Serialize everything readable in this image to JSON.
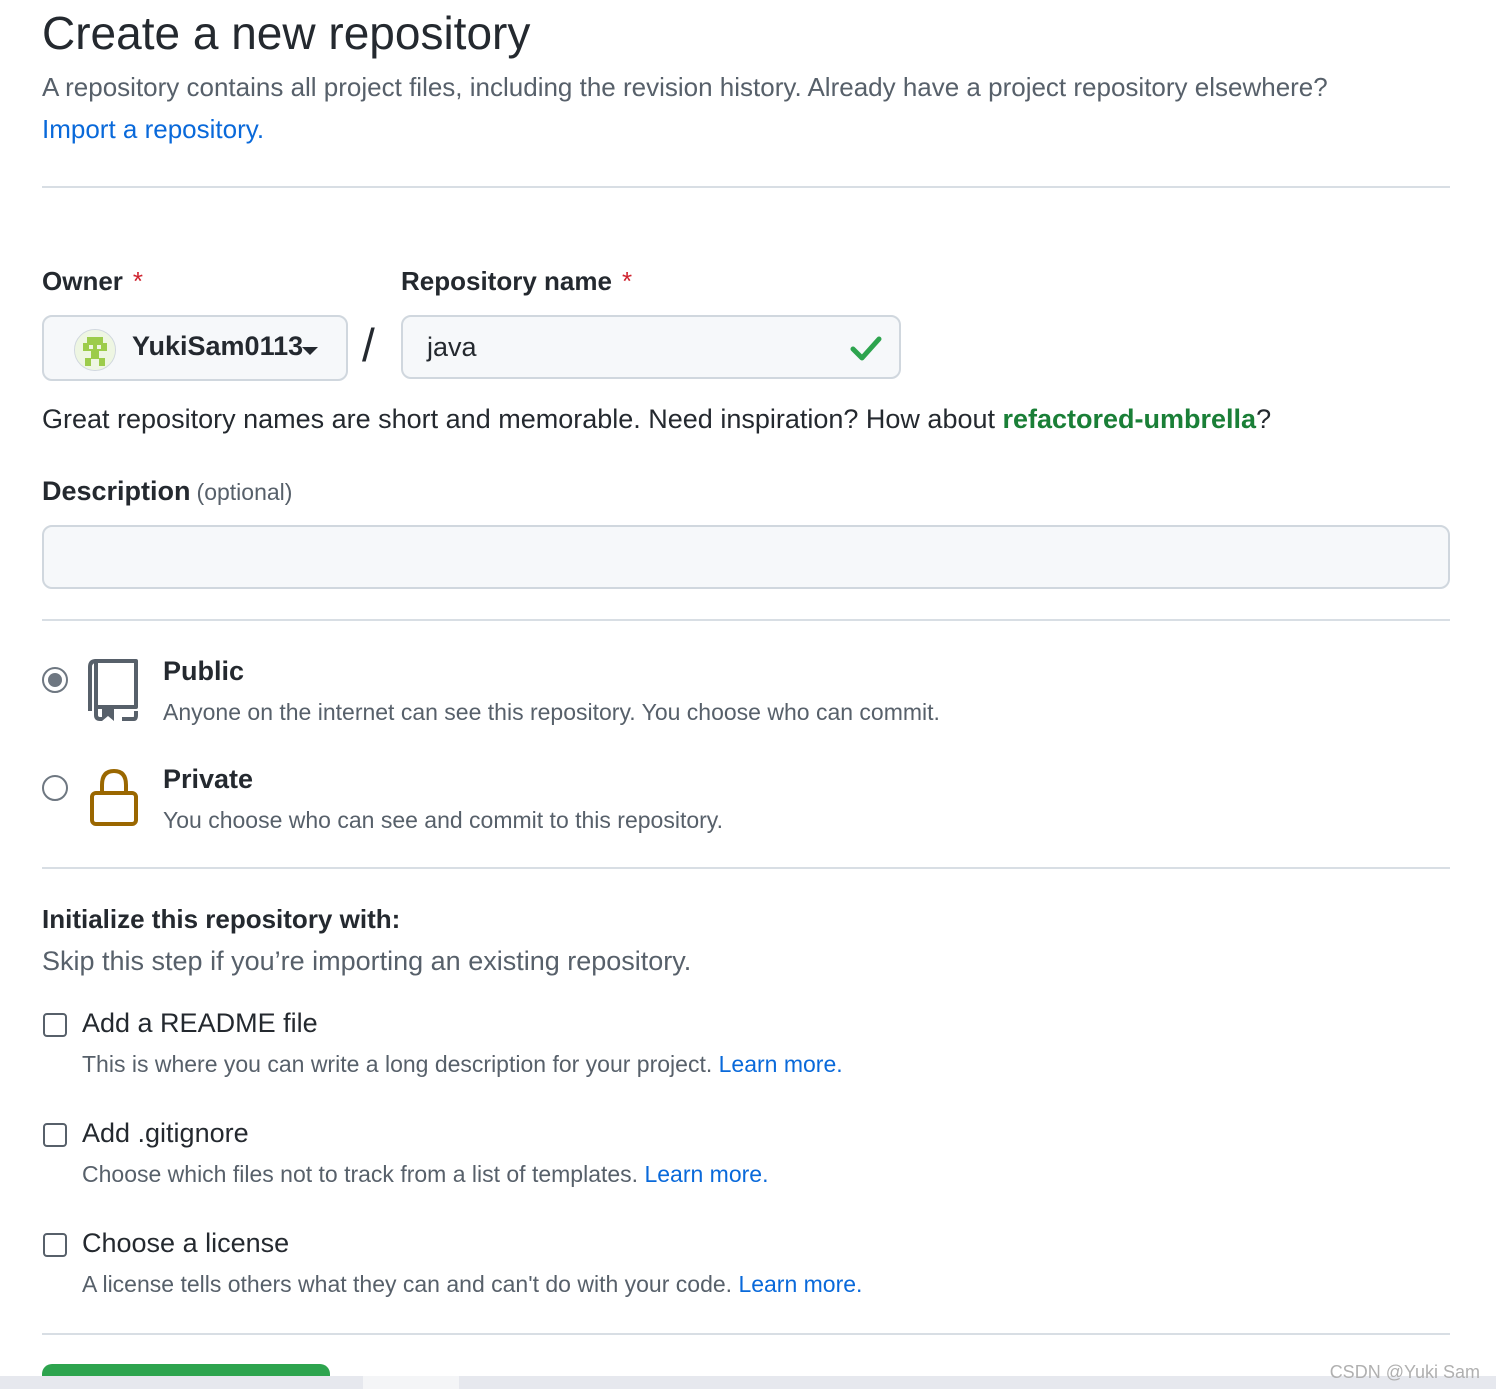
{
  "header": {
    "title": "Create a new repository",
    "subtitle": "A repository contains all project files, including the revision history. Already have a project repository elsewhere?",
    "import_link": "Import a repository."
  },
  "owner": {
    "label": "Owner",
    "required_mark": "*",
    "value": "YukiSam0113",
    "avatar_icon": "identicon-avatar",
    "dropdown_icon": "caret-down-icon"
  },
  "separator": "/",
  "repo_name": {
    "label": "Repository name",
    "required_mark": "*",
    "value": "java",
    "status_icon": "check-icon",
    "status_color": "#2da44e"
  },
  "hint": {
    "text": "Great repository names are short and memorable. Need inspiration? How about ",
    "suggestion": "refactored-umbrella",
    "suffix": "?"
  },
  "description": {
    "label": "Description",
    "optional": "(optional)",
    "value": ""
  },
  "visibility": {
    "options": [
      {
        "title": "Public",
        "desc": "Anyone on the internet can see this repository. You choose who can commit.",
        "icon": "repo-icon",
        "selected": true
      },
      {
        "title": "Private",
        "desc": "You choose who can see and commit to this repository.",
        "icon": "lock-icon",
        "selected": false
      }
    ]
  },
  "init": {
    "title": "Initialize this repository with:",
    "subtitle": "Skip this step if you’re importing an existing repository.",
    "items": [
      {
        "title": "Add a README file",
        "desc": "This is where you can write a long description for your project.",
        "link": "Learn more.",
        "checked": false
      },
      {
        "title": "Add .gitignore",
        "desc": "Choose which files not to track from a list of templates.",
        "link": "Learn more.",
        "checked": false
      },
      {
        "title": "Choose a license",
        "desc": "A license tells others what they can and can't do with your code.",
        "link": "Learn more.",
        "checked": false
      }
    ]
  },
  "watermark": "CSDN @Yuki Sam",
  "colors": {
    "link": "#0969da",
    "success": "#1a7f37",
    "primary_button": "#2da44e",
    "lock": "#9a6700"
  }
}
